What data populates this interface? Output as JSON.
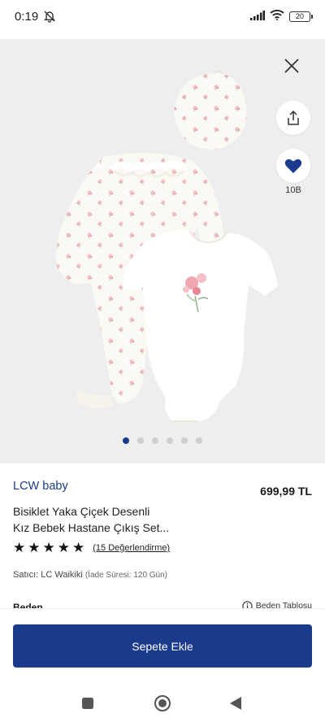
{
  "status_bar": {
    "time": "0:19",
    "battery": "20"
  },
  "hero": {
    "favorite_count": "10B",
    "carousel": {
      "total": 6,
      "active_index": 0
    }
  },
  "product": {
    "brand": "LCW baby",
    "price": "699,99 TL",
    "title_line1": "Bisiklet Yaka Çiçek Desenli",
    "title_line2": "Kız Bebek Hastane Çıkış Set...",
    "rating": 5,
    "reviews_label": "(15 Değerlendirme)",
    "seller_label": "Satıcı: LC Waikiki",
    "return_label": "(İade Süresi: 120 Gün)",
    "size_label": "Beden",
    "size_chart_label": "Beden Tablosu"
  },
  "actions": {
    "add_to_cart": "Sepete Ekle"
  },
  "colors": {
    "accent": "#1a3a8c",
    "background_image": "#eeeeee"
  },
  "icons": [
    "bell-off-icon",
    "signal-icon",
    "wifi-icon",
    "battery-icon",
    "close-icon",
    "share-icon",
    "heart-icon",
    "info-icon",
    "nav-recents-icon",
    "nav-home-icon",
    "nav-back-icon"
  ]
}
